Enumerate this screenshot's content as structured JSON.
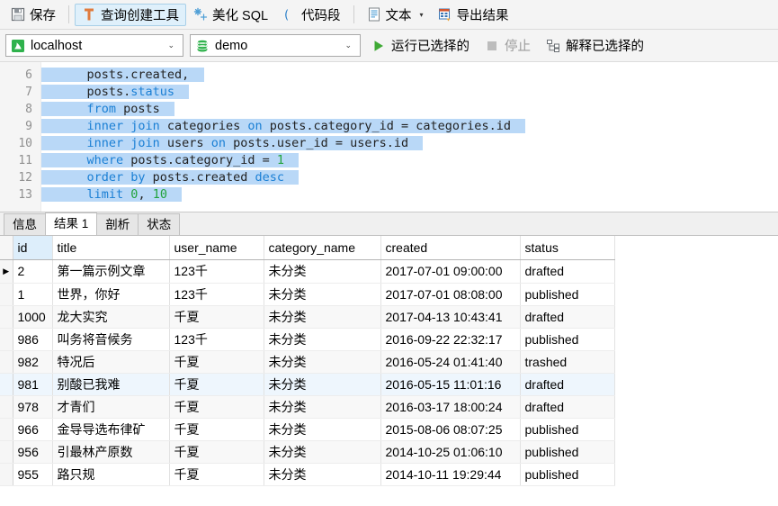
{
  "toolbar": {
    "buttons": [
      {
        "label": "保存",
        "icon": "save-icon",
        "active": false
      },
      {
        "label": "查询创建工具",
        "icon": "query-builder-icon",
        "active": true
      },
      {
        "label": "美化 SQL",
        "icon": "beautify-sql-icon",
        "active": false
      },
      {
        "label": "代码段",
        "icon": "code-snippet-icon",
        "active": false
      },
      {
        "label": "文本",
        "icon": "text-icon",
        "active": false,
        "caret": "▾"
      },
      {
        "label": "导出结果",
        "icon": "export-result-icon",
        "active": false
      }
    ]
  },
  "connection_bar": {
    "host": {
      "value": "localhost",
      "icon": "connection-icon",
      "arrow": "⌄"
    },
    "database": {
      "value": "demo",
      "icon": "database-icon",
      "arrow": "⌄"
    },
    "run_selected": {
      "label": "运行已选择的",
      "icon": "play-icon"
    },
    "stop": {
      "label": "停止",
      "icon": "stop-icon",
      "enabled": false
    },
    "explain_selected": {
      "label": "解释已选择的",
      "icon": "explain-icon"
    }
  },
  "editor": {
    "lines": [
      {
        "number": "6",
        "tokens": [
          {
            "t": "    posts.created,",
            "k": "plain"
          }
        ]
      },
      {
        "number": "7",
        "tokens": [
          {
            "t": "    posts.",
            "k": "plain"
          },
          {
            "t": "status",
            "k": "kw"
          }
        ]
      },
      {
        "number": "8",
        "tokens": [
          {
            "t": "    ",
            "k": "plain"
          },
          {
            "t": "from",
            "k": "kw"
          },
          {
            "t": " posts",
            "k": "plain"
          }
        ]
      },
      {
        "number": "9",
        "tokens": [
          {
            "t": "    ",
            "k": "plain"
          },
          {
            "t": "inner join",
            "k": "kw"
          },
          {
            "t": " categories ",
            "k": "plain"
          },
          {
            "t": "on",
            "k": "kw"
          },
          {
            "t": " posts.category_id = categories.id",
            "k": "plain"
          }
        ]
      },
      {
        "number": "10",
        "tokens": [
          {
            "t": "    ",
            "k": "plain"
          },
          {
            "t": "inner join",
            "k": "kw"
          },
          {
            "t": " users ",
            "k": "plain"
          },
          {
            "t": "on",
            "k": "kw"
          },
          {
            "t": " posts.user_id = users.id",
            "k": "plain"
          }
        ]
      },
      {
        "number": "11",
        "tokens": [
          {
            "t": "    ",
            "k": "plain"
          },
          {
            "t": "where",
            "k": "kw"
          },
          {
            "t": " posts.category_id = ",
            "k": "plain"
          },
          {
            "t": "1",
            "k": "num"
          }
        ]
      },
      {
        "number": "12",
        "tokens": [
          {
            "t": "    ",
            "k": "plain"
          },
          {
            "t": "order by",
            "k": "kw"
          },
          {
            "t": " posts.created ",
            "k": "plain"
          },
          {
            "t": "desc",
            "k": "kw"
          }
        ]
      },
      {
        "number": "13",
        "tokens": [
          {
            "t": "    ",
            "k": "plain"
          },
          {
            "t": "limit",
            "k": "kw"
          },
          {
            "t": " ",
            "k": "plain"
          },
          {
            "t": "0",
            "k": "num"
          },
          {
            "t": ", ",
            "k": "plain"
          },
          {
            "t": "10",
            "k": "num"
          }
        ]
      }
    ]
  },
  "result_tabs": [
    {
      "label": "信息",
      "active": false
    },
    {
      "label": "结果 1",
      "active": true
    },
    {
      "label": "剖析",
      "active": false
    },
    {
      "label": "状态",
      "active": false
    }
  ],
  "grid": {
    "columns": [
      {
        "name": "id",
        "selected": true
      },
      {
        "name": "title",
        "selected": false
      },
      {
        "name": "user_name",
        "selected": false
      },
      {
        "name": "category_name",
        "selected": false
      },
      {
        "name": "created",
        "selected": false
      },
      {
        "name": "status",
        "selected": false
      }
    ],
    "current_row_marker": "▶",
    "rows": [
      {
        "marker": true,
        "id": "2",
        "title": "第一篇示例文章",
        "user_name": "123千",
        "category_name": "未分类",
        "created": "2017-07-01 09:00:00",
        "status": "drafted"
      },
      {
        "marker": false,
        "id": "1",
        "title": "世界，你好",
        "user_name": "123千",
        "category_name": "未分类",
        "created": "2017-07-01 08:08:00",
        "status": "published"
      },
      {
        "marker": false,
        "id": "1000",
        "title": "龙大实究",
        "user_name": "千夏",
        "category_name": "未分类",
        "created": "2017-04-13 10:43:41",
        "status": "drafted"
      },
      {
        "marker": false,
        "id": "986",
        "title": "叫务将音候务",
        "user_name": "123千",
        "category_name": "未分类",
        "created": "2016-09-22 22:32:17",
        "status": "published"
      },
      {
        "marker": false,
        "id": "982",
        "title": "特况后",
        "user_name": "千夏",
        "category_name": "未分类",
        "created": "2016-05-24 01:41:40",
        "status": "trashed"
      },
      {
        "marker": false,
        "id": "981",
        "title": "别酸已我难",
        "user_name": "千夏",
        "category_name": "未分类",
        "created": "2016-05-15 11:01:16",
        "status": "drafted"
      },
      {
        "marker": false,
        "id": "978",
        "title": "才青们",
        "user_name": "千夏",
        "category_name": "未分类",
        "created": "2016-03-17 18:00:24",
        "status": "drafted"
      },
      {
        "marker": false,
        "id": "966",
        "title": "金导导选布律矿",
        "user_name": "千夏",
        "category_name": "未分类",
        "created": "2015-08-06 08:07:25",
        "status": "published"
      },
      {
        "marker": false,
        "id": "956",
        "title": "引最林产原数",
        "user_name": "千夏",
        "category_name": "未分类",
        "created": "2014-10-25 01:06:10",
        "status": "published"
      },
      {
        "marker": false,
        "id": "955",
        "title": "路只规",
        "user_name": "千夏",
        "category_name": "未分类",
        "created": "2014-10-11 19:29:44",
        "status": "published"
      }
    ]
  },
  "colors": {
    "toolbar_bg": "#f4f4f4",
    "active_button_bg": "#dff0fb",
    "selection_blue": "#b9d8f7",
    "keyword_blue": "#1a7fd4",
    "number_green": "#22a33c",
    "run_green": "#3faa35",
    "selected_column_bg": "#ddeefb",
    "row_highlight_bg": "#eef6fd"
  }
}
